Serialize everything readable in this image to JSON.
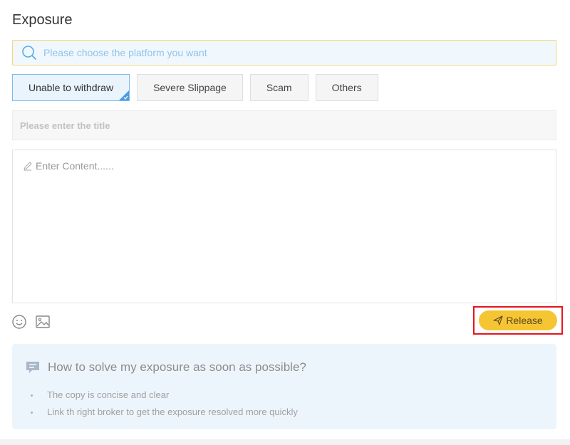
{
  "page": {
    "title": "Exposure"
  },
  "search": {
    "placeholder": "Please choose the platform you want",
    "icon": "search-icon"
  },
  "tags": [
    {
      "label": "Unable to withdraw",
      "active": true
    },
    {
      "label": "Severe Slippage",
      "active": false
    },
    {
      "label": "Scam",
      "active": false
    },
    {
      "label": "Others",
      "active": false
    }
  ],
  "title_input": {
    "placeholder": "Please enter the title"
  },
  "content": {
    "placeholder": "Enter Content......"
  },
  "toolbar": {
    "emoji_icon": "smiley-icon",
    "image_icon": "image-icon",
    "release_label": "Release"
  },
  "help": {
    "title": "How to solve my exposure as soon as possible?",
    "items": [
      "The copy is concise and clear",
      "Link th right broker to get the exposure resolved more quickly"
    ]
  },
  "colors": {
    "accent_yellow": "#f6c533",
    "highlight_red": "#e8141c",
    "active_blue": "#7fb8e8",
    "help_bg": "#edf5fc"
  }
}
